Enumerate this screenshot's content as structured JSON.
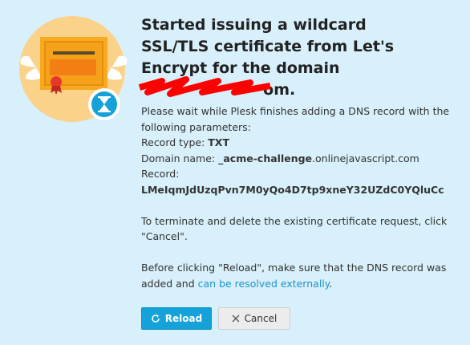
{
  "dialog": {
    "title_part1": "Started issuing a wildcard SSL/TLS certificate from Let's Encrypt for the domain",
    "title_part2": "om.",
    "intro": "Please wait while Plesk finishes adding a DNS record with the following parameters:",
    "record_type_label": "Record type:",
    "record_type_value": "TXT",
    "domain_name_label": "Domain name:",
    "domain_name_bold": "_acme-challenge",
    "domain_name_rest": ".onlinejavascript.com",
    "record_label": "Record:",
    "record_value": "LMeIqmJdUzqPvn7M0yQo4D7tp9xneY32UZdC0YQluCc",
    "terminate_text": "To terminate and delete the existing certificate request, click \"Cancel\".",
    "before_text": "Before clicking \"Reload\", make sure that the DNS record was added and",
    "link_text": "can be resolved externally",
    "link_suffix": "."
  },
  "buttons": {
    "reload_label": "Reload",
    "cancel_label": "Cancel"
  },
  "icons": {
    "illustration": "certificate-with-wings-icon",
    "badge": "hourglass-icon",
    "reload": "refresh-icon",
    "cancel": "close-icon"
  },
  "colors": {
    "background": "#d7f0fb",
    "accent": "#15a2d9",
    "link": "#1f93c7",
    "redaction": "#ff0000"
  }
}
